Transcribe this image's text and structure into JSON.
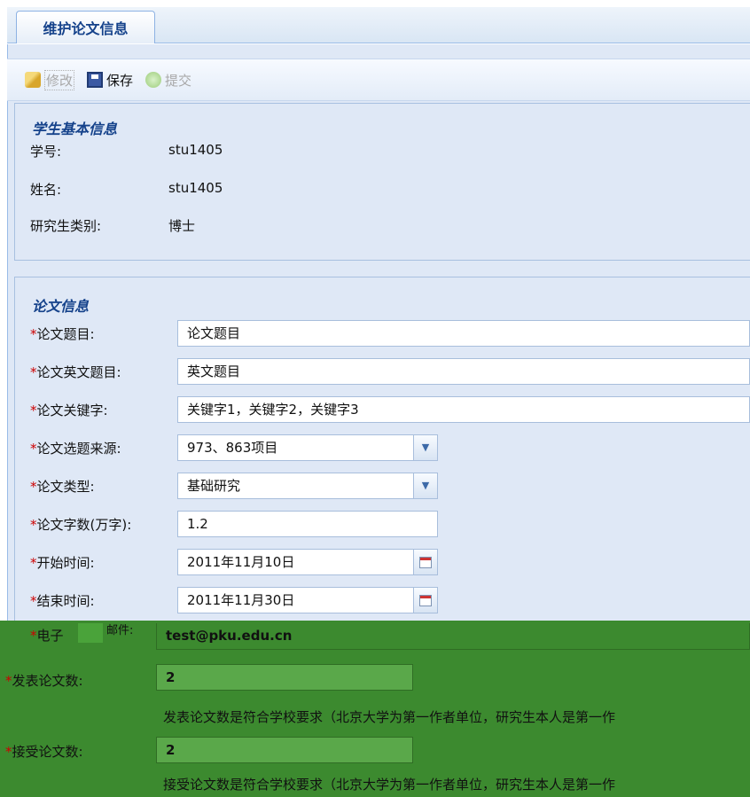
{
  "tab": {
    "label": "维护论文信息"
  },
  "toolbar": {
    "edit_label": "修改",
    "save_label": "保存",
    "submit_label": "提交"
  },
  "student": {
    "legend": "学生基本信息",
    "id_label": "学号:",
    "id_value": "stu1405",
    "name_label": "姓名:",
    "name_value": "stu1405",
    "type_label": "研究生类别:",
    "type_value": "博士"
  },
  "thesis": {
    "legend": "论文信息",
    "required_mark": "*",
    "title_label": "论文题目:",
    "title_value": "论文题目",
    "en_title_label": "论文英文题目:",
    "en_title_value": "英文题目",
    "keywords_label": "论文关键字:",
    "keywords_value": "关键字1，关键字2，关键字3",
    "source_label": "论文选题来源:",
    "source_value": "973、863项目",
    "kind_label": "论文类型:",
    "kind_value": "基础研究",
    "words_label": "论文字数(万字):",
    "words_value": "1.2",
    "start_label": "开始时间:",
    "start_value": "2011年11月10日",
    "end_label": "结束时间:",
    "end_value": "2011年11月30日"
  },
  "overlay": {
    "email_label_partial": "电子",
    "email_label_tail": "邮件:",
    "email_value": "test@pku.edu.cn",
    "published_label": "发表论文数:",
    "published_value": "2",
    "published_hint": "发表论文数是符合学校要求（北京大学为第一作者单位，研究生本人是第一作",
    "accepted_label": "接受论文数:",
    "accepted_value": "2",
    "accepted_hint": "接受论文数是符合学校要求（北京大学为第一作者单位，研究生本人是第一作"
  },
  "colors": {
    "accent": "#15428b",
    "panel_bg": "#dfe8f6",
    "required": "#cc0000",
    "overlay_green": "#3c8a2f"
  }
}
